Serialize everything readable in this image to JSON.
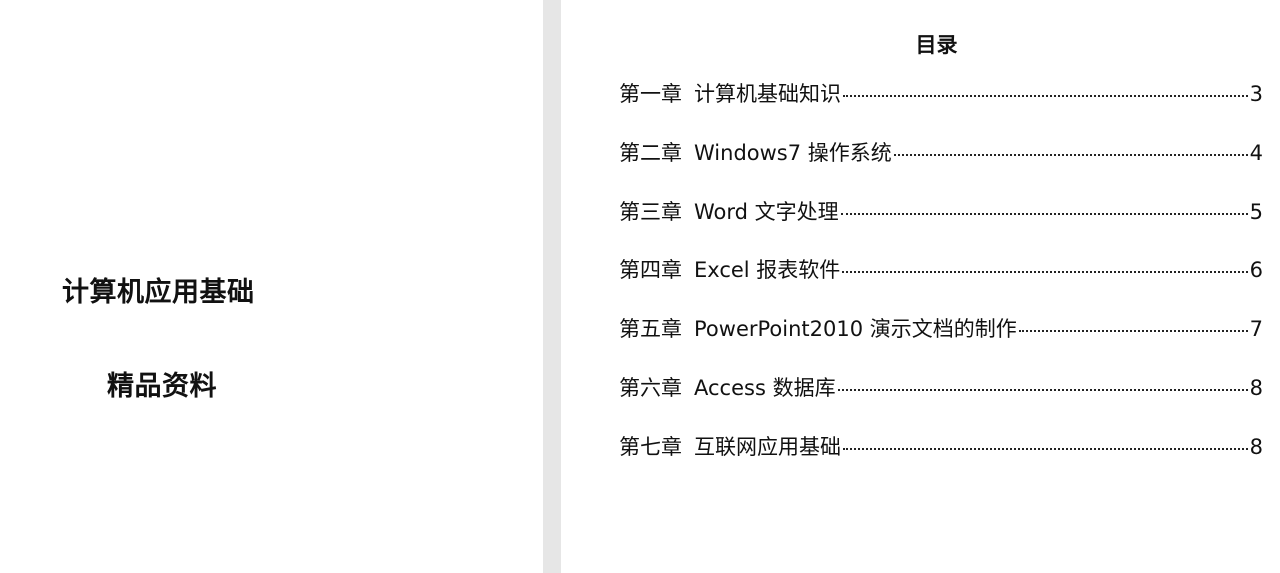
{
  "cover": {
    "title": "计算机应用基础",
    "subtitle": "精品资料"
  },
  "toc": {
    "heading": "目录",
    "entries": [
      {
        "chapter": "第一章",
        "title": "计算机基础知识",
        "page": "3"
      },
      {
        "chapter": "第二章",
        "title": "Windows7 操作系统",
        "page": "4"
      },
      {
        "chapter": "第三章",
        "title": "Word 文字处理",
        "page": "5"
      },
      {
        "chapter": "第四章",
        "title": "Excel 报表软件",
        "page": "6"
      },
      {
        "chapter": "第五章",
        "title": "PowerPoint2010 演示文档的制作",
        "page": "7"
      },
      {
        "chapter": "第六章",
        "title": "Access 数据库",
        "page": "8"
      },
      {
        "chapter": "第七章",
        "title": "互联网应用基础",
        "page": "8"
      }
    ]
  }
}
